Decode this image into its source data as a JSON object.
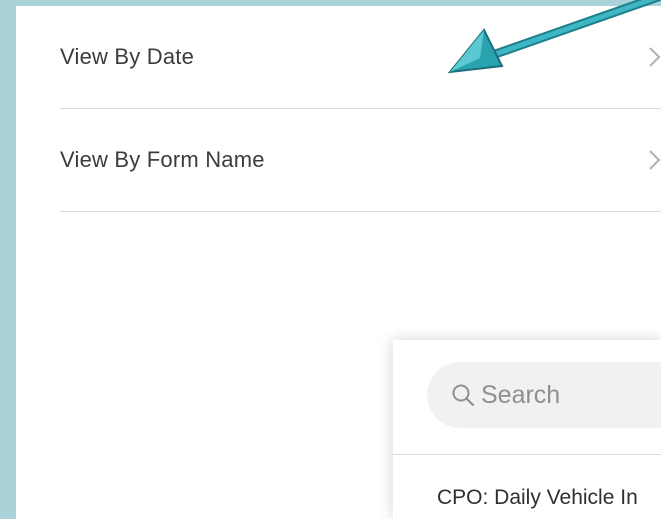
{
  "menu": {
    "items": [
      {
        "label": "View By Date"
      },
      {
        "label": "View By Form Name"
      }
    ]
  },
  "search": {
    "placeholder": "Search"
  },
  "results": {
    "first_item": "CPO: Daily Vehicle In"
  },
  "colors": {
    "background": "#a9d3d8",
    "arrow": "#2a9fad",
    "text": "#3c3c3c"
  }
}
